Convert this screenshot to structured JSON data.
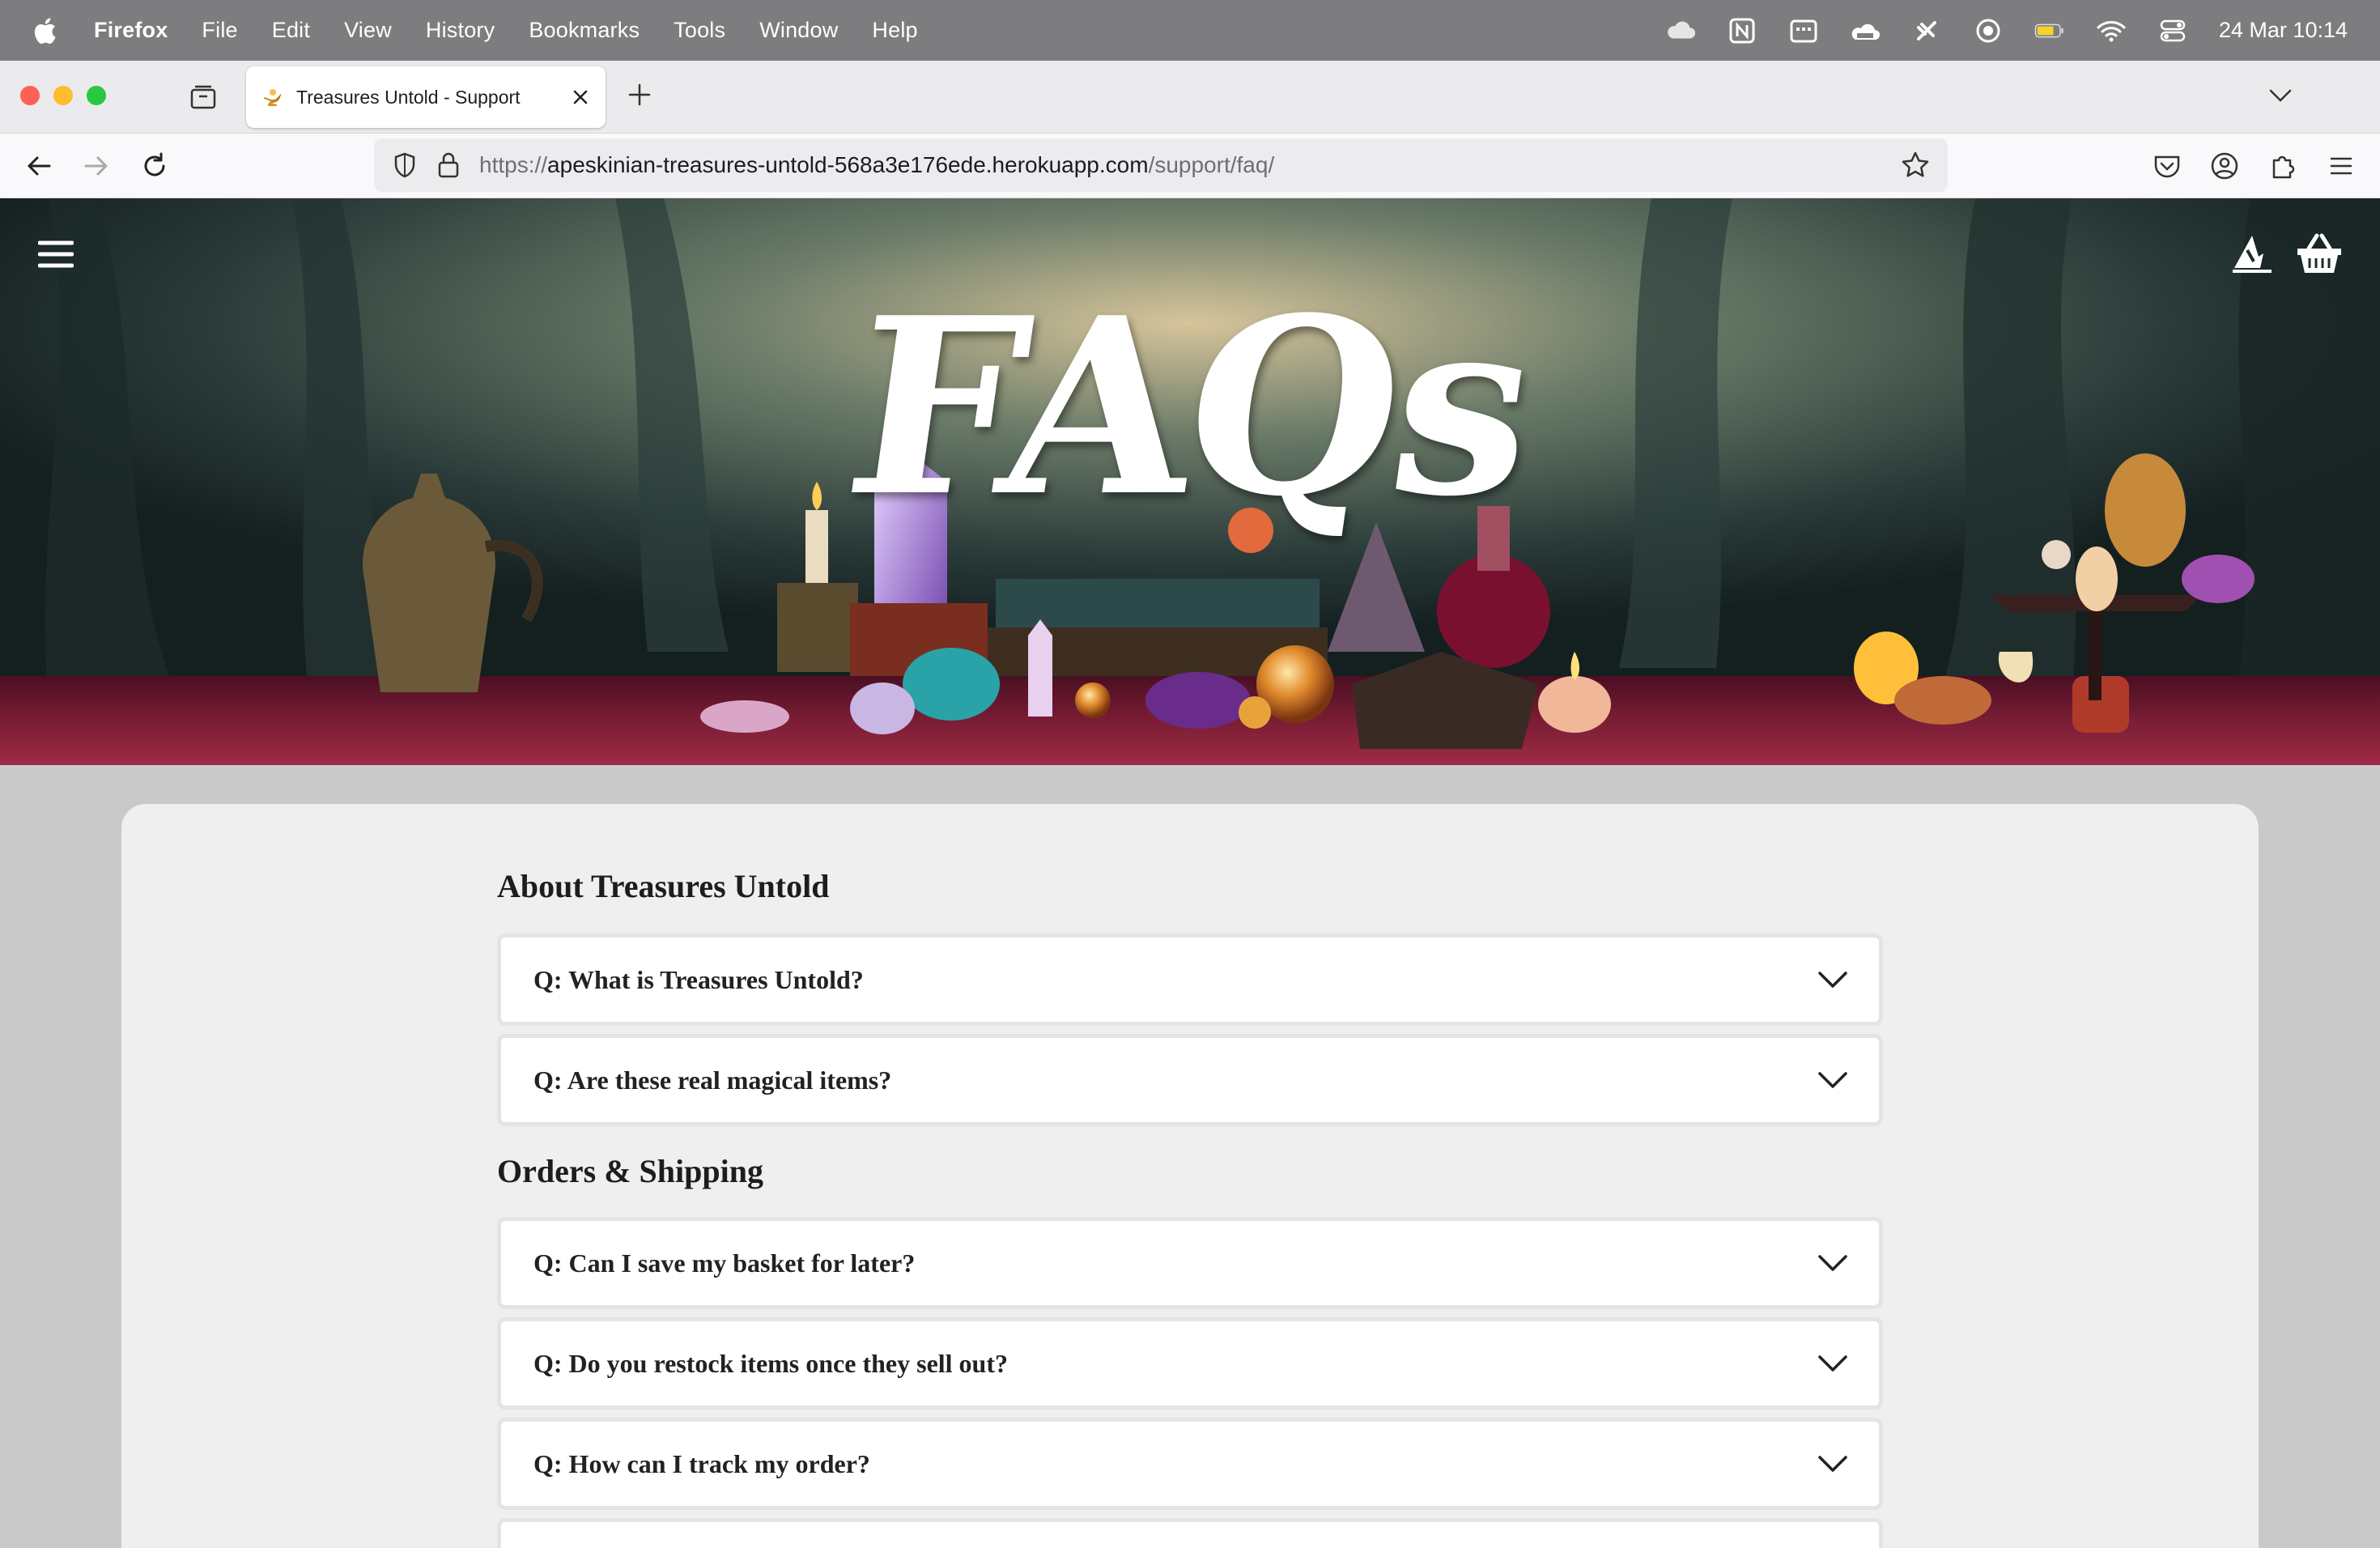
{
  "menubar": {
    "app": "Firefox",
    "items": [
      "File",
      "Edit",
      "View",
      "History",
      "Bookmarks",
      "Tools",
      "Window",
      "Help"
    ],
    "clock": "24 Mar  10:14",
    "status_icons": [
      "icloud-icon",
      "notion-icon",
      "calendar-icon",
      "cloud-app-icon",
      "paw-icon",
      "media-icon",
      "battery-icon",
      "wifi-icon",
      "control-center-icon"
    ]
  },
  "browser": {
    "tab_title": "Treasures Untold - Support",
    "url_prefix": "https://",
    "url_host": "apeskinian-treasures-untold-568a3e176ede.herokuapp.com",
    "url_path": "/support/faq/"
  },
  "hero": {
    "title": "FAQs"
  },
  "faq": {
    "sections": [
      {
        "heading": "About Treasures Untold",
        "questions": [
          "Q: What is Treasures Untold?",
          "Q: Are these real magical items?"
        ]
      },
      {
        "heading": "Orders & Shipping",
        "questions": [
          "Q: Can I save my basket for later?",
          "Q: Do you restock items once they sell out?",
          "Q: How can I track my order?"
        ]
      }
    ]
  },
  "colors": {
    "menubar_bg": "#7d7d80",
    "card_bg": "#efefef",
    "page_bg": "#c9c9c9",
    "hero_tablecloth": "#7a1d35"
  }
}
